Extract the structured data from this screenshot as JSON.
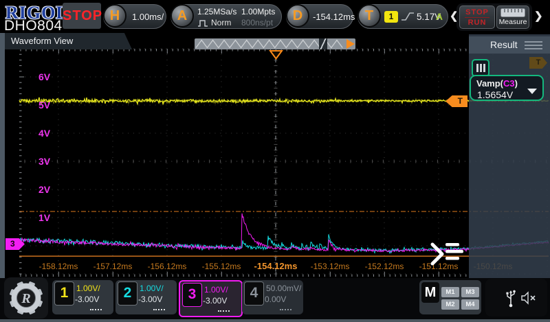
{
  "top_bar": {
    "brand": "RIGOL",
    "model": "DHO804",
    "acq_status": "STOP",
    "horizontal": {
      "key": "H",
      "scale": "1.00ms/"
    },
    "acquire": {
      "key": "A",
      "sample_rate": "1.25MSa/s",
      "mode": "Norm",
      "mem_depth": "1.00Mpts",
      "resolution": "800ns/pt"
    },
    "delay": {
      "key": "D",
      "value": "-154.12ms"
    },
    "trigger": {
      "key": "T",
      "source": "1",
      "level": "5.17V",
      "sweep": "A"
    },
    "nav": {
      "prev": "❮",
      "next": "❯"
    },
    "run_stop": {
      "stop": "STOP",
      "run": "RUN"
    },
    "measure": {
      "label": "Measure"
    }
  },
  "waveform_view": {
    "title": "Waveform View",
    "voltage_labels": [
      "6V",
      "5V",
      "4V",
      "3V",
      "2V",
      "1V"
    ],
    "time_labels": [
      "-158.12ms",
      "-157.12ms",
      "-156.12ms",
      "-155.12ms",
      "-154.12ms",
      "-153.12ms",
      "-152.12ms",
      "-151.12ms"
    ],
    "center_time_index": 4,
    "hidden_time_label": "-150.12ms",
    "trigger_marker_label": "T",
    "ch3_marker_label": "3",
    "dim_trigger_tab_label": "T"
  },
  "result_panel": {
    "title": "Result",
    "item": {
      "label_prefix": "Vamp(",
      "source": "C3",
      "label_suffix": ")",
      "value": "1.5654V"
    }
  },
  "bottom_bar": {
    "channels": [
      {
        "id": "1",
        "scale": "1.00V/",
        "offset": "-3.00V"
      },
      {
        "id": "2",
        "scale": "1.00V/",
        "offset": "-3.00V"
      },
      {
        "id": "3",
        "scale": "1.00V/",
        "offset": "-3.00V"
      },
      {
        "id": "4",
        "scale": "50.00mV/",
        "offset": "0.00V"
      }
    ],
    "math": {
      "key": "M",
      "m1": "M1",
      "m2": "M2",
      "m3": "M3",
      "m4": "M4"
    }
  },
  "icons": [
    "gear-logo-icon",
    "ruler-measure-icon",
    "rising-edge-icon",
    "pulse-norm-icon",
    "hamburger-icon",
    "usb-icon",
    "speaker-mute-icon",
    "dropdown-caret-icon",
    "expand-menu-icon",
    "minimap-play-icon"
  ],
  "colors": {
    "ch1": "#e6e61e",
    "ch2": "#16dbe0",
    "ch3": "#f31df3",
    "ch4": "#8b929a",
    "accent_orange": "#f78c1e",
    "time_label": "#c67a1f",
    "voltage_label": "#ee35ee",
    "result_green": "#14b87e",
    "run_stop_red": "#c32427"
  },
  "chart_data": {
    "type": "line",
    "x_unit": "ms",
    "y_unit": "V",
    "time_per_div_ms": 1.0,
    "volts_per_div": 1.0,
    "x_visible_range": [
      -158.84,
      -149.1
    ],
    "trigger": {
      "t_ms": -154.12,
      "level_v": 5.17,
      "source": "CH1"
    },
    "measure_lines_v": {
      "top": 1.22,
      "base": -0.37
    },
    "series": [
      {
        "name": "CH1",
        "color": "#e6e61e",
        "baseline_v": 5.15,
        "noise_vpp": 0.12,
        "base_points": [
          [
            -158.84,
            5.15
          ],
          [
            -149.1,
            5.15
          ]
        ],
        "spikes": []
      },
      {
        "name": "CH2",
        "color": "#16dbe0",
        "noise_vpp": 0.15,
        "base_points": [
          [
            -158.9,
            0.22
          ],
          [
            -157.0,
            0.1
          ],
          [
            -155.5,
            -0.02
          ],
          [
            -154.3,
            -0.08
          ],
          [
            -152.0,
            -0.16
          ],
          [
            -150.6,
            -0.1
          ],
          [
            -149.0,
            0.18
          ]
        ],
        "spikes": [
          {
            "t": -154.74,
            "h": 0.32,
            "d": 0.05
          },
          {
            "t": -154.26,
            "h": 0.46,
            "d": 0.09
          },
          {
            "t": -154.01,
            "h": 0.15,
            "d": 0.04
          },
          {
            "t": -153.83,
            "h": 0.22,
            "d": 0.05
          },
          {
            "t": -153.65,
            "h": 0.18,
            "d": 0.05
          },
          {
            "t": -153.48,
            "h": 0.25,
            "d": 0.06
          },
          {
            "t": -153.31,
            "h": 0.15,
            "d": 0.04
          },
          {
            "t": -153.15,
            "h": 0.58,
            "d": 0.07
          }
        ]
      },
      {
        "name": "CH3",
        "color": "#f31df3",
        "noise_vpp": 0.12,
        "base_points": [
          [
            -158.9,
            0.2
          ],
          [
            -157.0,
            0.06
          ],
          [
            -155.5,
            -0.05
          ],
          [
            -154.3,
            -0.1
          ],
          [
            -152.0,
            -0.18
          ],
          [
            -150.6,
            -0.12
          ],
          [
            -149.0,
            0.14
          ]
        ],
        "spikes": [
          {
            "t": -154.75,
            "h": 1.3,
            "d": 0.16
          },
          {
            "t": -153.83,
            "h": 0.08,
            "d": 0.04
          },
          {
            "t": -153.48,
            "h": 0.1,
            "d": 0.05
          },
          {
            "t": -153.15,
            "h": 0.4,
            "d": 0.06
          },
          {
            "t": -152.95,
            "h": 0.07,
            "d": 0.04
          }
        ]
      }
    ]
  }
}
